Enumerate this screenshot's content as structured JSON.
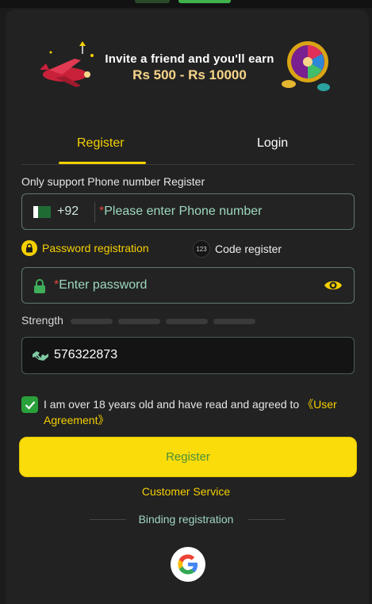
{
  "banner": {
    "line1": "Invite a friend and you'll earn",
    "line2": "Rs 500 - Rs 10000"
  },
  "tabs": [
    {
      "label": "Register",
      "active": true
    },
    {
      "label": "Login",
      "active": false
    }
  ],
  "phone": {
    "note": "Only support Phone number Register",
    "country_code": "+92",
    "required_mark": "*",
    "placeholder": "Please enter Phone number"
  },
  "methods": {
    "password": "Password registration",
    "code": "Code register",
    "code_badge": "123"
  },
  "password": {
    "required_mark": "*",
    "placeholder": "Enter password"
  },
  "strength": {
    "label": "Strength",
    "level": 0,
    "segments": 4
  },
  "code": {
    "value": "576322873"
  },
  "agreement": {
    "checked": true,
    "text": "I am over 18 years old and have read and agreed to ",
    "link": "《User Agreement》"
  },
  "register_button": "Register",
  "customer_service": "Customer Service",
  "binding": "Binding registration",
  "colors": {
    "accent": "#f5d000",
    "panel": "#222222",
    "field_border": "#5d7a6e",
    "check_green": "#2aa03a"
  }
}
